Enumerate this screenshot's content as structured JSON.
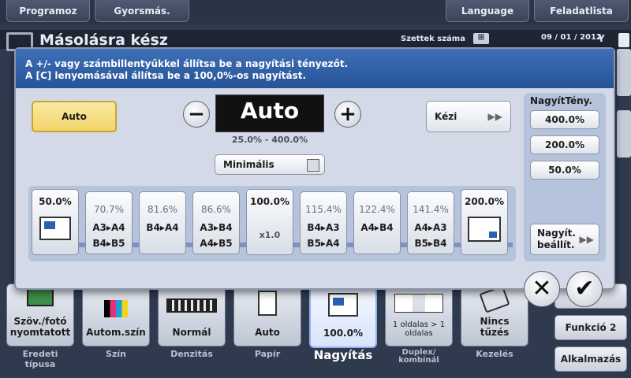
{
  "top": {
    "programs": "Programoz",
    "quick": "Gyorsmás.",
    "language": "Language",
    "joblist": "Feladatlista"
  },
  "status": {
    "title": "Másolásra kész",
    "sets_label": "Szettek száma",
    "date": "09 / 01 / 2012"
  },
  "message": {
    "line1": "A +/- vagy számbillentyűkkel állítsa be a nagyítási tényezőt.",
    "line2": "A [C] lenyomásával állítsa be a 100,0%-os nagyítást."
  },
  "panel": {
    "auto_button": "Auto",
    "display_value": "Auto",
    "range": "25.0% - 400.0%",
    "manual_button": "Kézi",
    "minimal_label": "Minimális",
    "minimal_checked": false,
    "zoom_presets": [
      {
        "pct": "50.0%",
        "a": "",
        "b": ""
      },
      {
        "pct": "70.7%",
        "a": "A3▸A4",
        "b": "B4▸B5"
      },
      {
        "pct": "81.6%",
        "a": "B4▸A4",
        "b": ""
      },
      {
        "pct": "86.6%",
        "a": "A3▸B4",
        "b": "A4▸B5"
      },
      {
        "pct": "100.0%",
        "a": "",
        "b": "x1.0"
      },
      {
        "pct": "115.4%",
        "a": "B4▸A3",
        "b": "B5▸A4"
      },
      {
        "pct": "122.4%",
        "a": "A4▸B4",
        "b": ""
      },
      {
        "pct": "141.4%",
        "a": "A4▸A3",
        "b": "B5▸B4"
      },
      {
        "pct": "200.0%",
        "a": "",
        "b": ""
      }
    ],
    "zoomratio": {
      "title": "NagyítTény.",
      "values": [
        "400.0%",
        "200.0%",
        "50.0%"
      ],
      "set_button_line1": "Nagyít.",
      "set_button_line2": "beállít."
    }
  },
  "side": {
    "func2": "Funkció 2",
    "apps": "Alkalmazás"
  },
  "tiles": [
    {
      "value_line1": "Szöv./fotó",
      "value_line2": "nyomtatott",
      "label": "Eredeti típusa"
    },
    {
      "value_line1": "Autom.szín",
      "value_line2": "",
      "label": "Szín"
    },
    {
      "value_line1": "Normál",
      "value_line2": "",
      "label": "Denzitás"
    },
    {
      "value_line1": "Auto",
      "value_line2": "",
      "label": "Papír"
    },
    {
      "value_line1": "100.0%",
      "value_line2": "",
      "label": "Nagyítás"
    },
    {
      "value_line1": "1 oldalas > 1 oldalas",
      "value_line2": "",
      "label": "Duplex/ kombinál"
    },
    {
      "value_line1": "Nincs",
      "value_line2": "tűzés",
      "label": "Kezelés"
    }
  ],
  "colors": {
    "accent_blue": "#2f62ad",
    "selected_yellow": "#f3d96b"
  }
}
